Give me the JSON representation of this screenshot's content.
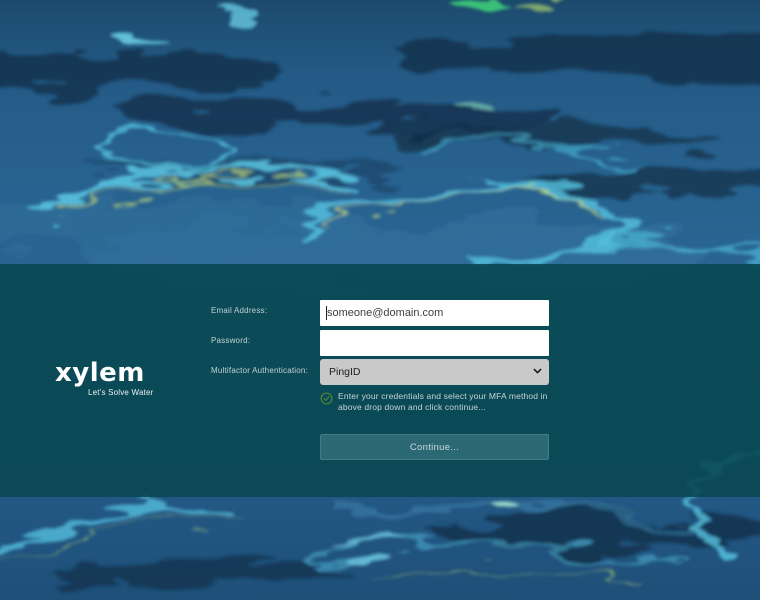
{
  "brand": {
    "logo_text": "xylem",
    "tagline": "Let's Solve Water"
  },
  "login_form": {
    "email_label": "Email Address:",
    "email_placeholder": "someone@domain.com",
    "password_label": "Password:",
    "password_value": "",
    "mfa_label": "Multifactor Authentication:",
    "mfa_selected_option": "PingID",
    "info_message": "Enter your credentials and select your MFA method in above drop down and click continue...",
    "continue_button_label": "Continue..."
  },
  "icons": {
    "check_circle": "check-circle-icon",
    "select_chevron": "chevron-down-icon"
  },
  "colors": {
    "overlay_band": "#07474e",
    "continue_button_bg": "#2b6a74",
    "check_icon_green": "#4d8038",
    "mfa_select_bg": "#c9c9c9",
    "label_text": "#c2d1d5",
    "water_deep_blue": "#2a6695",
    "water_dark_navy": "#132f47",
    "water_highlight_cyan": "#5fd0ea",
    "water_caustic_green": "#cfe37c"
  }
}
